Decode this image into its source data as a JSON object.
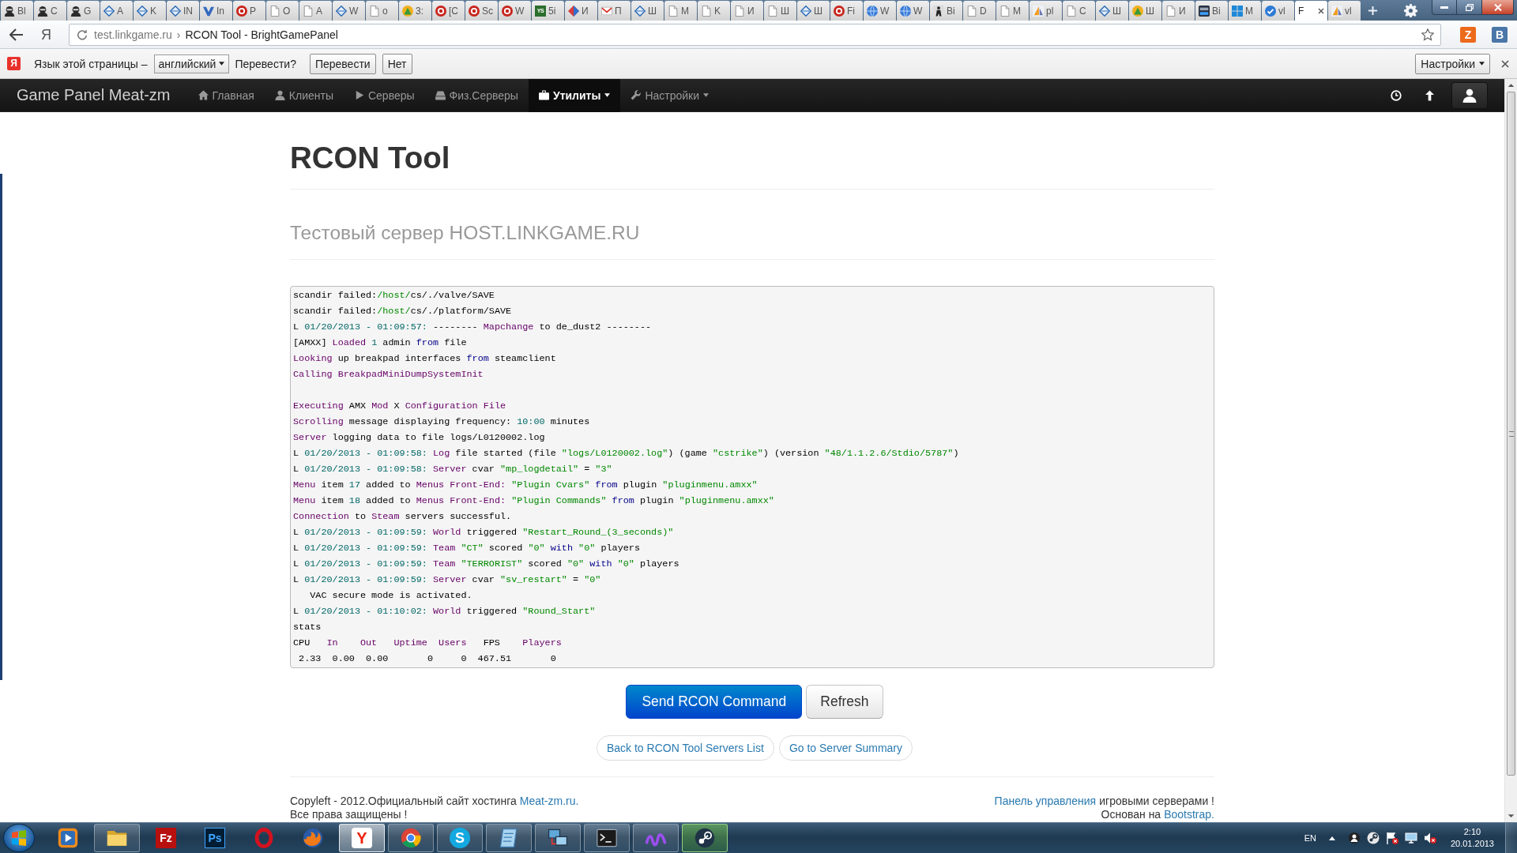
{
  "browser": {
    "tabs": [
      {
        "label": "Bl",
        "kind": "user",
        "selected": false
      },
      {
        "label": "C",
        "kind": "user",
        "selected": false
      },
      {
        "label": "G",
        "kind": "user",
        "selected": false
      },
      {
        "label": "A",
        "kind": "diamond",
        "selected": false
      },
      {
        "label": "K",
        "kind": "diamond",
        "selected": false
      },
      {
        "label": "IN",
        "kind": "diamond",
        "selected": false
      },
      {
        "label": "In",
        "kind": "check",
        "selected": false
      },
      {
        "label": "P",
        "kind": "redlogo",
        "selected": false
      },
      {
        "label": "O",
        "kind": "page",
        "selected": false
      },
      {
        "label": "A",
        "kind": "page",
        "selected": false
      },
      {
        "label": "W",
        "kind": "diamond",
        "selected": false
      },
      {
        "label": "o",
        "kind": "page",
        "selected": false
      },
      {
        "label": "3:",
        "kind": "tree",
        "selected": false
      },
      {
        "label": "[C",
        "kind": "redlogo",
        "selected": false
      },
      {
        "label": "Sc",
        "kind": "redlogo",
        "selected": false
      },
      {
        "label": "W",
        "kind": "redlogo",
        "selected": false
      },
      {
        "label": "5i",
        "kind": "glyph",
        "glyph": "YS",
        "selected": false
      },
      {
        "label": "И",
        "kind": "gem",
        "selected": false
      },
      {
        "label": "П",
        "kind": "mail",
        "selected": false
      },
      {
        "label": "Ш",
        "kind": "diamond",
        "selected": false
      },
      {
        "label": "M",
        "kind": "page",
        "selected": false
      },
      {
        "label": "K",
        "kind": "page",
        "selected": false
      },
      {
        "label": "И",
        "kind": "page",
        "selected": false
      },
      {
        "label": "Ш",
        "kind": "page",
        "selected": false
      },
      {
        "label": "Ш",
        "kind": "diamond",
        "selected": false
      },
      {
        "label": "Fi",
        "kind": "redlogo",
        "selected": false
      },
      {
        "label": "W",
        "kind": "globe",
        "selected": false
      },
      {
        "label": "W",
        "kind": "globe",
        "selected": false
      },
      {
        "label": "Bi",
        "kind": "figure",
        "selected": false
      },
      {
        "label": "D",
        "kind": "page",
        "selected": false
      },
      {
        "label": "M",
        "kind": "page",
        "selected": false
      },
      {
        "label": "pl",
        "kind": "sail",
        "selected": false
      },
      {
        "label": "C",
        "kind": "page",
        "selected": false
      },
      {
        "label": "Ш",
        "kind": "diamond",
        "selected": false
      },
      {
        "label": "Ш",
        "kind": "tree",
        "selected": false
      },
      {
        "label": "И",
        "kind": "page",
        "selected": false
      },
      {
        "label": "Bi",
        "kind": "badge",
        "selected": false
      },
      {
        "label": "M",
        "kind": "squares",
        "selected": false
      },
      {
        "label": "vl",
        "kind": "checkcircle",
        "selected": false
      },
      {
        "label": "F",
        "kind": "none",
        "selected": true
      },
      {
        "label": "vl",
        "kind": "sail",
        "selected": false
      }
    ],
    "logo": "Я",
    "address": {
      "host": "test.linkgame.ru",
      "separator": "›",
      "title": "RCON Tool - BrightGamePanel"
    },
    "extensions": [
      {
        "kind": "orange",
        "glyph": "Z"
      },
      {
        "kind": "blue",
        "glyph": "В"
      }
    ]
  },
  "translate_bar": {
    "logo": "Я",
    "prompt": "Язык этой страницы –",
    "language": "английский",
    "question": "Перевести?",
    "buttons": [
      "Перевести",
      "Нет"
    ],
    "settings": "Настройки"
  },
  "navbar": {
    "brand": "Game Panel Meat-zm",
    "items": [
      {
        "label": "Главная",
        "kind": "home",
        "dropdown": false,
        "selected": false
      },
      {
        "label": "Клиенты",
        "kind": "user",
        "dropdown": false,
        "selected": false
      },
      {
        "label": "Серверы",
        "kind": "play",
        "dropdown": false,
        "selected": false
      },
      {
        "label": "Физ.Серверы",
        "kind": "hdd",
        "dropdown": false,
        "selected": false
      },
      {
        "label": "Утилиты",
        "kind": "briefcase",
        "dropdown": true,
        "selected": true
      },
      {
        "label": "Настройки",
        "kind": "wrench",
        "dropdown": true,
        "selected": false
      }
    ]
  },
  "page": {
    "title": "RCON Tool",
    "subtitle": "Тестовый сервер HOST.LINKGAME.RU",
    "console": {
      "blocks": [
        [
          [
            {
              "text": "scandir failed:",
              "kind": "plain"
            },
            {
              "text": "/host/",
              "kind": "string"
            },
            {
              "text": "cs/./valve/SAVE",
              "kind": "plain"
            }
          ],
          [
            {
              "text": "scandir failed:",
              "kind": "plain"
            },
            {
              "text": "/host/",
              "kind": "string"
            },
            {
              "text": "cs/./platform/SAVE",
              "kind": "plain"
            }
          ],
          [
            {
              "text": "L ",
              "kind": "plain"
            },
            {
              "text": "01/20/2013 - 01:09:57:",
              "kind": "literal"
            },
            {
              "text": " -------- ",
              "kind": "plain"
            },
            {
              "text": "Mapchange",
              "kind": "type"
            },
            {
              "text": " to de_dust2 --------",
              "kind": "plain"
            }
          ],
          [
            {
              "text": "[AMXX] ",
              "kind": "plain"
            },
            {
              "text": "Loaded ",
              "kind": "type"
            },
            {
              "text": "1",
              "kind": "literal"
            },
            {
              "text": " admin ",
              "kind": "plain"
            },
            {
              "text": "from",
              "kind": "keyword"
            },
            {
              "text": " file",
              "kind": "plain"
            }
          ],
          [
            {
              "text": "Looking",
              "kind": "type"
            },
            {
              "text": " up breakpad interfaces ",
              "kind": "plain"
            },
            {
              "text": "from",
              "kind": "keyword"
            },
            {
              "text": " steamclient",
              "kind": "plain"
            }
          ],
          [
            {
              "text": "Calling BreakpadMiniDumpSystemInit",
              "kind": "type"
            }
          ]
        ],
        [
          [
            {
              "text": "Executing",
              "kind": "type"
            },
            {
              "text": " AMX ",
              "kind": "plain"
            },
            {
              "text": "Mod",
              "kind": "type"
            },
            {
              "text": " X ",
              "kind": "plain"
            },
            {
              "text": "Configuration File",
              "kind": "type"
            }
          ],
          [
            {
              "text": "Scrolling",
              "kind": "type"
            },
            {
              "text": " message displaying frequency: ",
              "kind": "plain"
            },
            {
              "text": "10:00",
              "kind": "literal"
            },
            {
              "text": " minutes",
              "kind": "plain"
            }
          ],
          [
            {
              "text": "Server",
              "kind": "type"
            },
            {
              "text": " logging data to file logs/L0120002.log",
              "kind": "plain"
            }
          ],
          [
            {
              "text": "L ",
              "kind": "plain"
            },
            {
              "text": "01/20/2013 - 01:09:58: ",
              "kind": "literal"
            },
            {
              "text": "Log",
              "kind": "type"
            },
            {
              "text": " file started (file ",
              "kind": "plain"
            },
            {
              "text": "\"logs/L0120002.log\"",
              "kind": "string"
            },
            {
              "text": ") (game ",
              "kind": "plain"
            },
            {
              "text": "\"cstrike\"",
              "kind": "string"
            },
            {
              "text": ") (version ",
              "kind": "plain"
            },
            {
              "text": "\"48/1.1.2.6/Stdio/5787\"",
              "kind": "string"
            },
            {
              "text": ")",
              "kind": "plain"
            }
          ],
          [
            {
              "text": "L ",
              "kind": "plain"
            },
            {
              "text": "01/20/2013 - 01:09:58: ",
              "kind": "literal"
            },
            {
              "text": "Server",
              "kind": "type"
            },
            {
              "text": " cvar ",
              "kind": "plain"
            },
            {
              "text": "\"mp_logdetail\"",
              "kind": "string"
            },
            {
              "text": " = ",
              "kind": "plain"
            },
            {
              "text": "\"3\"",
              "kind": "string"
            }
          ],
          [
            {
              "text": "Menu",
              "kind": "type"
            },
            {
              "text": " item ",
              "kind": "plain"
            },
            {
              "text": "17",
              "kind": "literal"
            },
            {
              "text": " added to ",
              "kind": "plain"
            },
            {
              "text": "Menus Front-End: ",
              "kind": "type"
            },
            {
              "text": "\"Plugin Cvars\" ",
              "kind": "string"
            },
            {
              "text": "from",
              "kind": "keyword"
            },
            {
              "text": " plugin ",
              "kind": "plain"
            },
            {
              "text": "\"pluginmenu.amxx\"",
              "kind": "string"
            }
          ],
          [
            {
              "text": "Menu",
              "kind": "type"
            },
            {
              "text": " item ",
              "kind": "plain"
            },
            {
              "text": "18",
              "kind": "literal"
            },
            {
              "text": " added to ",
              "kind": "plain"
            },
            {
              "text": "Menus Front-End: ",
              "kind": "type"
            },
            {
              "text": "\"Plugin Commands\" ",
              "kind": "string"
            },
            {
              "text": "from",
              "kind": "keyword"
            },
            {
              "text": " plugin ",
              "kind": "plain"
            },
            {
              "text": "\"pluginmenu.amxx\"",
              "kind": "string"
            }
          ],
          [
            {
              "text": "Connection",
              "kind": "type"
            },
            {
              "text": " to ",
              "kind": "plain"
            },
            {
              "text": "Steam",
              "kind": "type"
            },
            {
              "text": " servers successful.",
              "kind": "plain"
            }
          ],
          [
            {
              "text": "L ",
              "kind": "plain"
            },
            {
              "text": "01/20/2013 - 01:09:59: ",
              "kind": "literal"
            },
            {
              "text": "World",
              "kind": "type"
            },
            {
              "text": " triggered ",
              "kind": "plain"
            },
            {
              "text": "\"Restart_Round_(3_seconds)\"",
              "kind": "string"
            }
          ],
          [
            {
              "text": "L ",
              "kind": "plain"
            },
            {
              "text": "01/20/2013 - 01:09:59: ",
              "kind": "literal"
            },
            {
              "text": "Team ",
              "kind": "type"
            },
            {
              "text": "\"CT\"",
              "kind": "string"
            },
            {
              "text": " scored ",
              "kind": "plain"
            },
            {
              "text": "\"0\" ",
              "kind": "string"
            },
            {
              "text": "with",
              "kind": "keyword"
            },
            {
              "text": " \"0\"",
              "kind": "string"
            },
            {
              "text": " players",
              "kind": "plain"
            }
          ],
          [
            {
              "text": "L ",
              "kind": "plain"
            },
            {
              "text": "01/20/2013 - 01:09:59: ",
              "kind": "literal"
            },
            {
              "text": "Team ",
              "kind": "type"
            },
            {
              "text": "\"TERRORIST\"",
              "kind": "string"
            },
            {
              "text": " scored ",
              "kind": "plain"
            },
            {
              "text": "\"0\" ",
              "kind": "string"
            },
            {
              "text": "with",
              "kind": "keyword"
            },
            {
              "text": " \"0\"",
              "kind": "string"
            },
            {
              "text": " players",
              "kind": "plain"
            }
          ],
          [
            {
              "text": "L ",
              "kind": "plain"
            },
            {
              "text": "01/20/2013 - 01:09:59: ",
              "kind": "literal"
            },
            {
              "text": "Server",
              "kind": "type"
            },
            {
              "text": " cvar ",
              "kind": "plain"
            },
            {
              "text": "\"sv_restart\"",
              "kind": "string"
            },
            {
              "text": " = ",
              "kind": "plain"
            },
            {
              "text": "\"0\"",
              "kind": "string"
            }
          ],
          [
            {
              "text": "   VAC secure mode is activated.",
              "kind": "plain"
            }
          ],
          [
            {
              "text": "L ",
              "kind": "plain"
            },
            {
              "text": "01/20/2013 - 01:10:02: ",
              "kind": "literal"
            },
            {
              "text": "World",
              "kind": "type"
            },
            {
              "text": " triggered ",
              "kind": "plain"
            },
            {
              "text": "\"Round_Start\"",
              "kind": "string"
            }
          ],
          [
            {
              "text": "stats",
              "kind": "plain"
            }
          ],
          [
            {
              "text": "CPU   ",
              "kind": "plain"
            },
            {
              "text": "In    Out   Uptime  Users",
              "kind": "type"
            },
            {
              "text": "   FPS    ",
              "kind": "plain"
            },
            {
              "text": "Players",
              "kind": "type"
            }
          ],
          [
            {
              "text": " 2.33  0.00  0.00       0     0  467.51       0",
              "kind": "plain"
            }
          ]
        ]
      ]
    },
    "buttons": [
      {
        "label": "Send RCON Command",
        "kind": "primary"
      },
      {
        "label": "Refresh",
        "kind": "default"
      }
    ],
    "links": [
      "Back to RCON Tool Servers List",
      "Go to Server Summary"
    ],
    "footer": {
      "left": [
        [
          {
            "text": "Copyleft - 2012.Официальный сайт хостинга",
            "link": false
          },
          {
            "text": "Meat-zm.ru.",
            "link": true
          }
        ],
        [
          {
            "text": "Все права защищены !",
            "link": false
          }
        ]
      ],
      "right": [
        [
          {
            "text": "Панель управления",
            "link": true
          },
          {
            "text": "игровыми серверами !",
            "link": false
          }
        ],
        [
          {
            "text": "Основан на",
            "link": false
          },
          {
            "text": "Bootstrap.",
            "link": true
          }
        ]
      ]
    }
  },
  "taskbar": {
    "items": [
      {
        "kind": "media",
        "running": false,
        "selected": false,
        "hovered": false
      },
      {
        "kind": "folder",
        "running": true,
        "selected": false,
        "hovered": false
      },
      {
        "kind": "fz",
        "glyph": "Fz",
        "running": false,
        "selected": false,
        "hovered": false
      },
      {
        "kind": "ps",
        "glyph": "Ps",
        "running": false,
        "selected": false,
        "hovered": false
      },
      {
        "kind": "opera",
        "running": false,
        "selected": false,
        "hovered": false
      },
      {
        "kind": "firefox",
        "running": false,
        "selected": false,
        "hovered": false
      },
      {
        "kind": "yandex",
        "glyph": "Y",
        "running": true,
        "selected": true,
        "hovered": false
      },
      {
        "kind": "chrome",
        "running": true,
        "selected": false,
        "hovered": false
      },
      {
        "kind": "skype",
        "glyph": "S",
        "running": true,
        "selected": false,
        "hovered": false
      },
      {
        "kind": "notepad",
        "running": true,
        "selected": false,
        "hovered": false
      },
      {
        "kind": "network",
        "running": true,
        "selected": false,
        "hovered": false
      },
      {
        "kind": "terminal",
        "running": true,
        "selected": false,
        "hovered": false
      },
      {
        "kind": "wave",
        "running": true,
        "selected": false,
        "hovered": false
      },
      {
        "kind": "steam",
        "running": true,
        "selected": false,
        "hovered": true
      }
    ],
    "tray": {
      "language": "EN",
      "time": "2:10",
      "date": "20.01.2013"
    }
  }
}
